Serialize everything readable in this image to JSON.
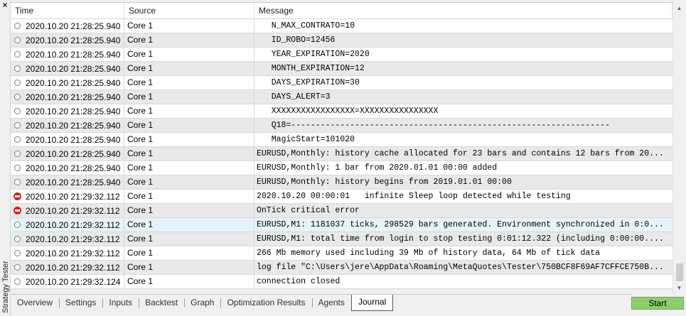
{
  "panel": {
    "title": "Strategy Tester",
    "close_glyph": "×"
  },
  "columns": {
    "time": "Time",
    "source": "Source",
    "message": "Message"
  },
  "log": [
    {
      "icon": "info-icon",
      "time": "2020.10.20 21:28:25.940",
      "source": "Core 1",
      "message": "   N_MAX_CONTRATO=10"
    },
    {
      "icon": "info-icon",
      "time": "2020.10.20 21:28:25.940",
      "source": "Core 1",
      "message": "   ID_ROBO=12456"
    },
    {
      "icon": "info-icon",
      "time": "2020.10.20 21:28:25.940",
      "source": "Core 1",
      "message": "   YEAR_EXPIRATION=2020"
    },
    {
      "icon": "info-icon",
      "time": "2020.10.20 21:28:25.940",
      "source": "Core 1",
      "message": "   MONTH_EXPIRATION=12"
    },
    {
      "icon": "info-icon",
      "time": "2020.10.20 21:28:25.940",
      "source": "Core 1",
      "message": "   DAYS_EXPIRATION=30"
    },
    {
      "icon": "info-icon",
      "time": "2020.10.20 21:28:25.940",
      "source": "Core 1",
      "message": "   DAYS_ALERT=3"
    },
    {
      "icon": "info-icon",
      "time": "2020.10.20 21:28:25.940",
      "source": "Core 1",
      "message": "   XXXXXXXXXXXXXXXXX=XXXXXXXXXXXXXXXX"
    },
    {
      "icon": "info-icon",
      "time": "2020.10.20 21:28:25.940",
      "source": "Core 1",
      "message": "   Q18=-----------------------------------------------------------------"
    },
    {
      "icon": "info-icon",
      "time": "2020.10.20 21:28:25.940",
      "source": "Core 1",
      "message": "   MagicStart=101020"
    },
    {
      "icon": "info-icon",
      "time": "2020.10.20 21:28:25.940",
      "source": "Core 1",
      "message": "EURUSD,Monthly: history cache allocated for 23 bars and contains 12 bars from 20..."
    },
    {
      "icon": "info-icon",
      "time": "2020.10.20 21:28:25.940",
      "source": "Core 1",
      "message": "EURUSD,Monthly: 1 bar from 2020.01.01 00:00 added"
    },
    {
      "icon": "info-icon",
      "time": "2020.10.20 21:28:25.940",
      "source": "Core 1",
      "message": "EURUSD,Monthly: history begins from 2019.01.01 00:00"
    },
    {
      "icon": "error-icon",
      "time": "2020.10.20 21:29:32.112",
      "source": "Core 1",
      "message": "2020.10.20 00:00:01   infinite Sleep loop detected while testing"
    },
    {
      "icon": "error-icon",
      "time": "2020.10.20 21:29:32.112",
      "source": "Core 1",
      "message": "OnTick critical error"
    },
    {
      "icon": "info-icon",
      "time": "2020.10.20 21:29:32.112",
      "source": "Core 1",
      "message": "EURUSD,M1: 1181037 ticks, 298529 bars generated. Environment synchronized in 0:0..."
    },
    {
      "icon": "info-icon",
      "time": "2020.10.20 21:29:32.112",
      "source": "Core 1",
      "message": "EURUSD,M1: total time from login to stop testing 0:01:12.322 (including 0:00:00...."
    },
    {
      "icon": "info-icon",
      "time": "2020.10.20 21:29:32.112",
      "source": "Core 1",
      "message": "266 Mb memory used including 39 Mb of history data, 64 Mb of tick data"
    },
    {
      "icon": "info-icon",
      "time": "2020.10.20 21:29:32.112",
      "source": "Core 1",
      "message": "log file \"C:\\Users\\jere\\AppData\\Roaming\\MetaQuotes\\Tester\\750BCF8F69AF7CFFCE750B..."
    },
    {
      "icon": "info-icon",
      "time": "2020.10.20 21:29:32.124",
      "source": "Core 1",
      "message": "connection closed"
    }
  ],
  "selected_row": 14,
  "tabs": [
    {
      "label": "Overview"
    },
    {
      "label": "Settings"
    },
    {
      "label": "Inputs"
    },
    {
      "label": "Backtest"
    },
    {
      "label": "Graph"
    },
    {
      "label": "Optimization Results"
    },
    {
      "label": "Agents"
    },
    {
      "label": "Journal"
    }
  ],
  "active_tab": "Journal",
  "start_button": "Start",
  "colors": {
    "start_button": "#8fce6f",
    "error_icon": "#d42020",
    "selected_row": "#e5f3fb",
    "alt_row": "#e9e9e9"
  }
}
